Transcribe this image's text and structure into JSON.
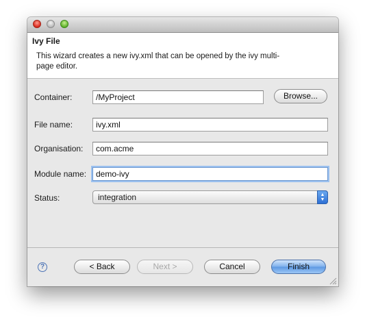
{
  "window": {
    "header_title": "Ivy File",
    "description": "This wizard creates a new ivy.xml that can be opened by the ivy multi-page editor."
  },
  "form": {
    "container": {
      "label": "Container:",
      "value": "/MyProject"
    },
    "browse_label": "Browse...",
    "file_name": {
      "label": "File name:",
      "value": "ivy.xml"
    },
    "organisation": {
      "label": "Organisation:",
      "value": "com.acme"
    },
    "module_name": {
      "label": "Module name:",
      "value": "demo-ivy"
    },
    "status": {
      "label": "Status:",
      "value": "integration"
    }
  },
  "footer": {
    "help_icon": "question-mark-icon",
    "back_label": "< Back",
    "next_label": "Next >",
    "cancel_label": "Cancel",
    "finish_label": "Finish"
  }
}
